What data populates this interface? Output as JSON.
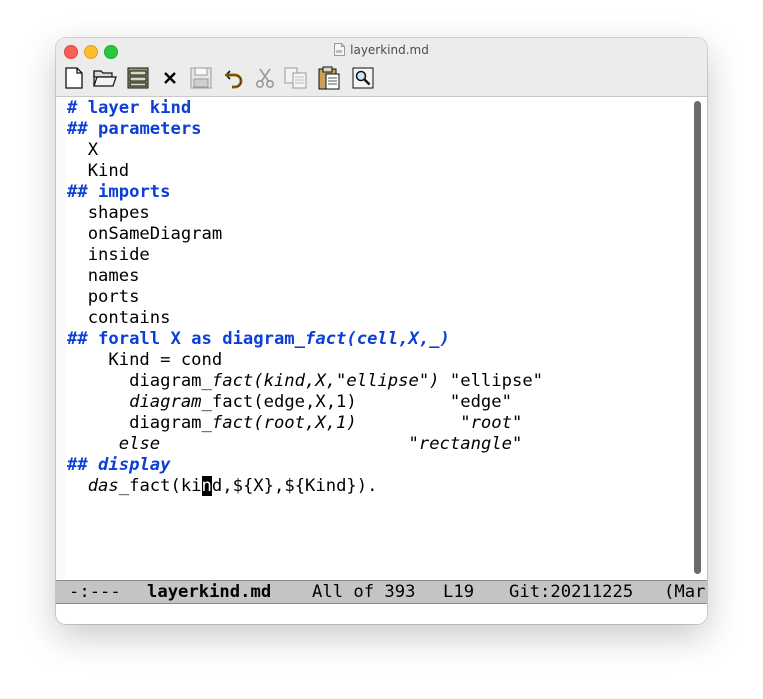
{
  "window": {
    "title": "layerkind.md"
  },
  "toolbar": {
    "items": [
      {
        "icon": "new-file-icon"
      },
      {
        "icon": "open-folder-icon"
      },
      {
        "icon": "dired-icon"
      },
      {
        "icon": "close-icon"
      },
      {
        "icon": "save-icon"
      },
      {
        "icon": "undo-icon"
      },
      {
        "icon": "cut-icon"
      },
      {
        "icon": "copy-icon"
      },
      {
        "icon": "paste-icon"
      },
      {
        "icon": "search-icon"
      }
    ]
  },
  "buffer": {
    "lines": [
      [
        {
          "t": "# ",
          "c": "h"
        },
        {
          "t": "layer kind",
          "c": "h"
        }
      ],
      [
        {
          "t": "## ",
          "c": "h"
        },
        {
          "t": "parameters",
          "c": "h"
        }
      ],
      [
        {
          "t": "  X"
        }
      ],
      [
        {
          "t": "  Kind"
        }
      ],
      [
        {
          "t": "## ",
          "c": "h"
        },
        {
          "t": "imports",
          "c": "h"
        }
      ],
      [
        {
          "t": "  shapes"
        }
      ],
      [
        {
          "t": "  onSameDiagram"
        }
      ],
      [
        {
          "t": "  inside"
        }
      ],
      [
        {
          "t": "  names"
        }
      ],
      [
        {
          "t": "  ports"
        }
      ],
      [
        {
          "t": "  contains"
        }
      ],
      [
        {
          "t": "## forall X as diagram_",
          "c": "h"
        },
        {
          "t": "fact(cell,X,_)",
          "c": "h i"
        }
      ],
      [
        {
          "t": "    Kind = cond"
        }
      ],
      [
        {
          "t": "      diagram_"
        },
        {
          "t": "fact(kind,X,\"ellipse\")",
          "c": "i"
        },
        {
          "t": " \"ellipse\""
        }
      ],
      [
        {
          "t": "      "
        },
        {
          "t": "diagram",
          "c": "i"
        },
        {
          "t": "_fact(edge,X,1)         \"edge\""
        }
      ],
      [
        {
          "t": "      diagram_"
        },
        {
          "t": "fact(root,X,1)",
          "c": "i"
        },
        {
          "t": "          \""
        },
        {
          "t": "root",
          "c": "i"
        },
        {
          "t": "\""
        }
      ],
      [
        {
          "t": "     "
        },
        {
          "t": "else",
          "c": "i"
        },
        {
          "t": "                        \""
        },
        {
          "t": "rectangle",
          "c": "i"
        },
        {
          "t": "\""
        }
      ],
      [
        {
          "t": "## ",
          "c": "h"
        },
        {
          "t": "display",
          "c": "h i"
        }
      ],
      [
        {
          "t": "  "
        },
        {
          "t": "das",
          "c": "i"
        },
        {
          "t": "_fact(ki"
        },
        {
          "t": "n",
          "c": "cursor"
        },
        {
          "t": "d,${X},${Kind})."
        }
      ]
    ]
  },
  "modeline": {
    "status": "-:---",
    "buffer_name": "layerkind.md",
    "position": "All of 393",
    "line": "L19",
    "vc": "Git:20211225",
    "mode": "(Mar"
  }
}
